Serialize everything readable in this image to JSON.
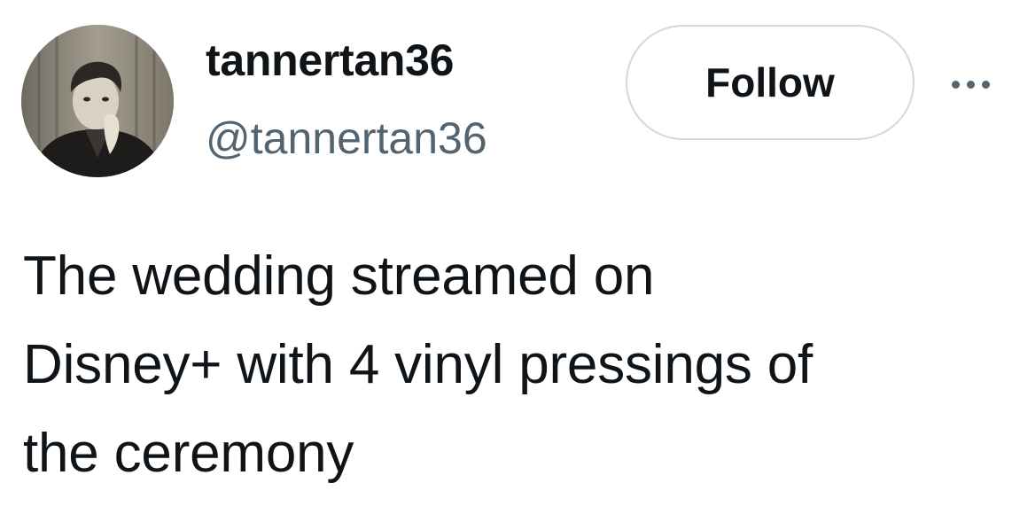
{
  "author": {
    "display_name": "tannertan36",
    "handle": "@tannertan36",
    "avatar_icon": "profile-photo"
  },
  "actions": {
    "follow_label": "Follow",
    "more_icon": "more-horizontal-icon"
  },
  "tweet": {
    "text": "The wedding streamed on\nDisney+ with 4 vinyl pressings of\nthe ceremony"
  },
  "colors": {
    "text_primary": "#0f1419",
    "text_secondary": "#536471",
    "button_border": "#cfd9de"
  }
}
